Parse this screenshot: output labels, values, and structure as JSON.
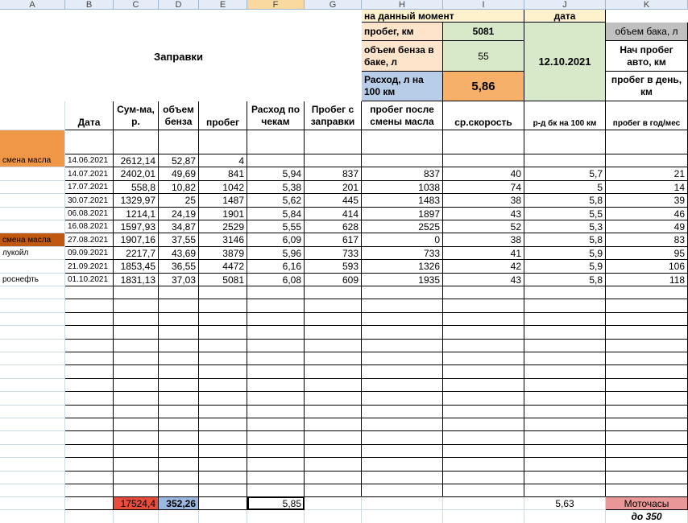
{
  "columns": [
    "A",
    "B",
    "C",
    "D",
    "E",
    "F",
    "G",
    "H",
    "I",
    "J",
    "K"
  ],
  "top_panel": {
    "moment_label": "на данный момент",
    "date_label": "дата",
    "probeg_label": "пробег, км",
    "probeg_value": "5081",
    "tank_label": "объем бака, л",
    "benz_label": "объем бенза в баке, л",
    "benz_value": "55",
    "date_value": "12.10.2021",
    "start_probeg_label": "Нач пробег авто, км",
    "rashod_label": "Расход, л на 100 км",
    "rashod_value": "5,86",
    "probeg_day_label": "пробег в день, км",
    "title": "Заправки"
  },
  "headers": {
    "date": "Дата",
    "sum": "Сум-ма, р.",
    "volume": "объем бенза",
    "probeg": "пробег",
    "rashod_check": "Расход по чекам",
    "probeg_zapravki": "Пробег с заправки",
    "probeg_maslo": "пробег после смены масла",
    "speed": "ср.скорость",
    "rd_bk": "р-д бк на 100 км",
    "probeg_god": "пробег в год/мес"
  },
  "rows": [
    {
      "a": "смена масла",
      "date": "14.06.2021",
      "sum": "2612,14",
      "vol": "52,87",
      "probeg": "4",
      "rash": "",
      "pz": "",
      "pm": "",
      "spd": "",
      "rd": "",
      "pg": ""
    },
    {
      "a": "",
      "date": "14.07.2021",
      "sum": "2402,01",
      "vol": "49,69",
      "probeg": "841",
      "rash": "5,94",
      "pz": "837",
      "pm": "837",
      "spd": "40",
      "rd": "5,7",
      "pg": "21"
    },
    {
      "a": "",
      "date": "17.07.2021",
      "sum": "558,8",
      "vol": "10,82",
      "probeg": "1042",
      "rash": "5,38",
      "pz": "201",
      "pm": "1038",
      "spd": "74",
      "rd": "5",
      "pg": "14"
    },
    {
      "a": "",
      "date": "30.07.2021",
      "sum": "1329,97",
      "vol": "25",
      "probeg": "1487",
      "rash": "5,62",
      "pz": "445",
      "pm": "1483",
      "spd": "38",
      "rd": "5,8",
      "pg": "39"
    },
    {
      "a": "",
      "date": "06.08.2021",
      "sum": "1214,1",
      "vol": "24,19",
      "probeg": "1901",
      "rash": "5,84",
      "pz": "414",
      "pm": "1897",
      "spd": "43",
      "rd": "5,5",
      "pg": "46"
    },
    {
      "a": "",
      "date": "16.08.2021",
      "sum": "1597,93",
      "vol": "34,87",
      "probeg": "2529",
      "rash": "5,55",
      "pz": "628",
      "pm": "2525",
      "spd": "52",
      "rd": "5,3",
      "pg": "49"
    },
    {
      "a": "смена масла",
      "date": "27.08.2021",
      "sum": "1907,16",
      "vol": "37,55",
      "probeg": "3146",
      "rash": "6,09",
      "pz": "617",
      "pm": "0",
      "spd": "38",
      "rd": "5,8",
      "pg": "83"
    },
    {
      "a": "лукойл",
      "date": "09.09.2021",
      "sum": "2217,7",
      "vol": "43,69",
      "probeg": "3879",
      "rash": "5,96",
      "pz": "733",
      "pm": "733",
      "spd": "41",
      "rd": "5,9",
      "pg": "95"
    },
    {
      "a": "",
      "date": "21.09.2021",
      "sum": "1853,45",
      "vol": "36,55",
      "probeg": "4472",
      "rash": "6,16",
      "pz": "593",
      "pm": "1326",
      "spd": "42",
      "rd": "5,9",
      "pg": "106"
    },
    {
      "a": "роснефть",
      "date": "01.10.2021",
      "sum": "1831,13",
      "vol": "37,03",
      "probeg": "5081",
      "rash": "6,08",
      "pz": "609",
      "pm": "1935",
      "spd": "43",
      "rd": "5,8",
      "pg": "118"
    }
  ],
  "totals": {
    "sum": "17524,4",
    "vol": "352,26",
    "rash": "5,85",
    "rd": "5,63",
    "moto_label": "Моточасы",
    "moto_note": "до 350"
  },
  "colors": {
    "orange_label": "#f09647",
    "dark_orange_label": "#c0590f",
    "peach": "#fde4cb",
    "light_green": "#d7e9c8",
    "light_yellow": "#fef2cc",
    "light_blue": "#b8cde8",
    "orange_value": "#f7b06a",
    "gray": "#c0c0c0",
    "red_total": "#e74c3c",
    "blue_total": "#9ab8e0",
    "pink": "#e89896"
  }
}
